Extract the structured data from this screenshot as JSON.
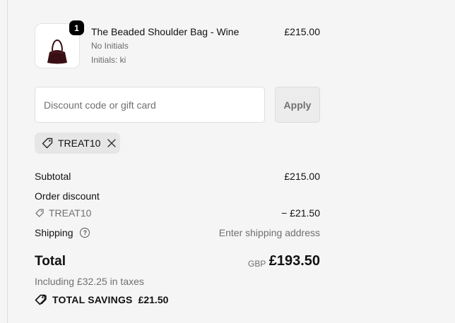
{
  "line_item": {
    "quantity": "1",
    "title": "The Beaded Shoulder Bag - Wine",
    "variant_line1": "No Initials",
    "variant_line2": "Initials: ki",
    "price": "£215.00",
    "thumbnail_icon": "bag-thumbnail"
  },
  "discount": {
    "placeholder": "Discount code or gift card",
    "apply_label": "Apply",
    "applied_code": "TREAT10"
  },
  "summary": {
    "subtotal_label": "Subtotal",
    "subtotal_value": "£215.00",
    "order_discount_label": "Order discount",
    "discount_code": "TREAT10",
    "discount_value": "− £21.50",
    "shipping_label": "Shipping",
    "shipping_help": "?",
    "shipping_value": "Enter shipping address",
    "total_label": "Total",
    "currency": "GBP",
    "total_value": "£193.50",
    "taxes_note": "Including £32.25 in taxes",
    "savings_label": "TOTAL SAVINGS",
    "savings_value": "£21.50"
  },
  "colors": {
    "background": "#f5f5f5",
    "bag": "#3a0f14"
  }
}
